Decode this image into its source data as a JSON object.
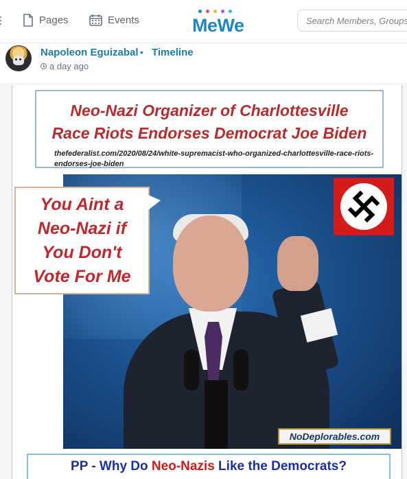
{
  "nav": {
    "pages_label": "Pages",
    "events_label": "Events",
    "logo_text": "MeWe",
    "logo_dot_colors": [
      "#1e86c8",
      "#ef4b5c",
      "#f7b733",
      "#9b5de5",
      "#2ec4b6"
    ]
  },
  "search": {
    "placeholder": "Search Members, Groups"
  },
  "post": {
    "author": "Napoleon Eguizabal",
    "separator": "•",
    "location": "Timeline",
    "time": "a day ago"
  },
  "image": {
    "headline_line1": "Neo-Nazi Organizer of Charlottesville",
    "headline_line2": "Race Riots Endorses Democrat Joe Biden",
    "url": "thefederalist.com/2020/08/24/white-supremacist-who-organized-charlottesville-race-riots-endorses-joe-biden",
    "speech_lines": [
      "You Aint a",
      "Neo-Nazi if",
      "You Don't",
      "Vote For Me"
    ],
    "watermark": "NoDeplorables.com",
    "caption_pre": "PP - Why Do ",
    "caption_highlight": "Neo-Nazis",
    "caption_post": " Like the Democrats?"
  },
  "colors": {
    "accent": "#1a7fa8",
    "headline_red": "#b92a2a",
    "caption_blue": "#1b2fa3"
  }
}
